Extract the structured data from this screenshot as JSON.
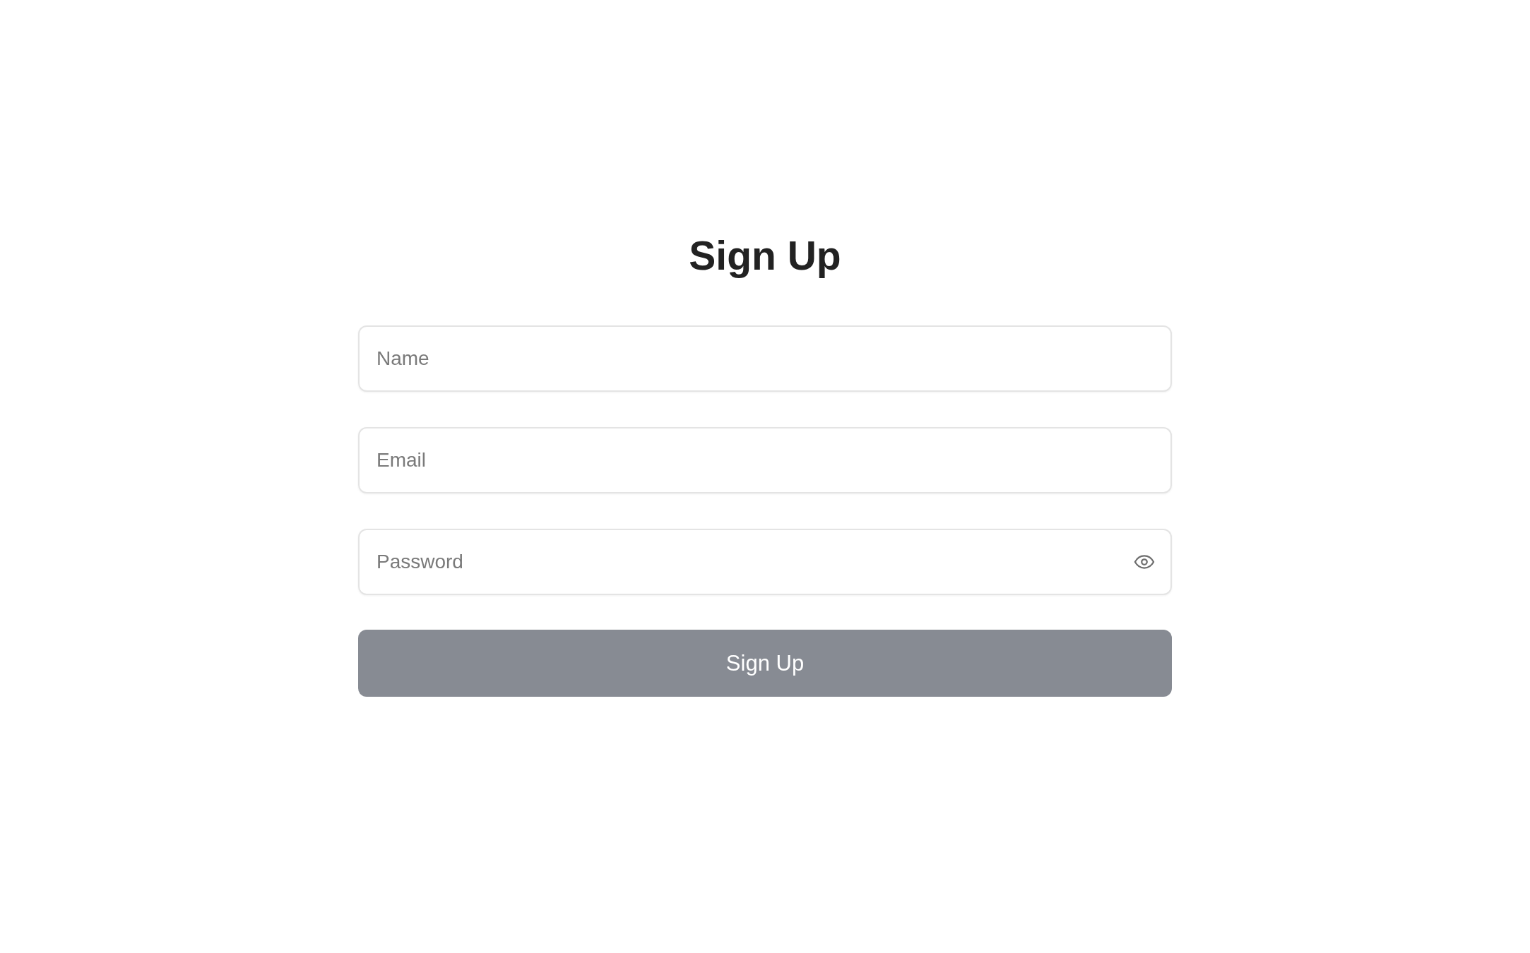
{
  "title": "Sign Up",
  "fields": [
    {
      "kind": "text",
      "placeholder": "Name"
    },
    {
      "kind": "email",
      "placeholder": "Email"
    },
    {
      "kind": "password",
      "placeholder": "Password"
    }
  ],
  "submit": {
    "label": "Sign Up",
    "disabled": true
  }
}
